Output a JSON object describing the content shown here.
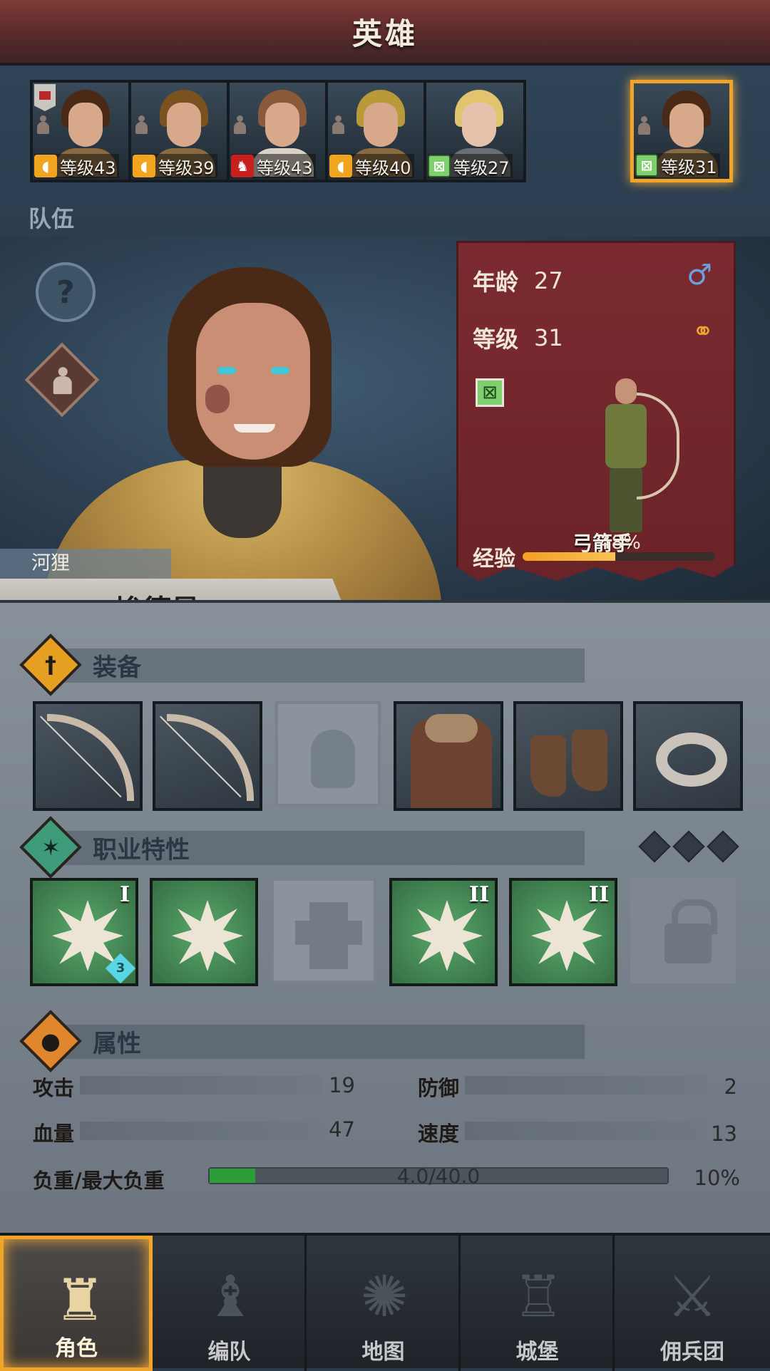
{
  "header": {
    "title": "英雄"
  },
  "roster": [
    {
      "class_icon": "shield-icon",
      "level": "等级43",
      "selected": false,
      "hair": "#4a2a16"
    },
    {
      "class_icon": "shield-icon",
      "level": "等级39",
      "selected": false,
      "hair": "#7a5220"
    },
    {
      "class_icon": "beast-icon",
      "level": "等级43",
      "selected": false,
      "hair": "#8a5a3a"
    },
    {
      "class_icon": "shield-icon",
      "level": "等级40",
      "selected": false,
      "hair": "#b89a3a"
    },
    {
      "class_icon": "bow-icon",
      "level": "等级27",
      "selected": false,
      "hair": "#e2c36e"
    },
    {
      "class_icon": "bow-icon",
      "level": "等级31",
      "selected": true,
      "hair": "#4a2a16"
    }
  ],
  "team_label": "队伍",
  "hero": {
    "nickname": "河狸",
    "name": "埃德曼",
    "age_label": "年龄",
    "age": "27",
    "level_label": "等级",
    "level": "31",
    "class_name": "弓箭手",
    "xp_label": "经验",
    "xp_percent": 48,
    "xp_text": "48%"
  },
  "equipment": {
    "title": "装备"
  },
  "traits": {
    "title": "职业特性"
  },
  "skills": [
    {
      "rank": "I",
      "gem": "3"
    },
    {
      "rank": "",
      "gem": ""
    },
    {
      "rank": "II",
      "gem": ""
    },
    {
      "rank": "II",
      "gem": ""
    }
  ],
  "attributes": {
    "title": "属性",
    "attack_label": "攻击",
    "attack": "19",
    "defense_label": "防御",
    "defense": "2",
    "hp_label": "血量",
    "hp": "47",
    "speed_label": "速度",
    "speed": "13",
    "load_label": "负重/最大负重",
    "load": "4.0/40.0",
    "load_percent": "10%",
    "load_fraction": 0.1
  },
  "nav": [
    {
      "label": "角色",
      "icon": "knight-icon",
      "active": true
    },
    {
      "label": "编队",
      "icon": "helmet-icon",
      "active": false
    },
    {
      "label": "地图",
      "icon": "compass-icon",
      "active": false
    },
    {
      "label": "城堡",
      "icon": "castle-icon",
      "active": false
    },
    {
      "label": "佣兵团",
      "icon": "mercenary-icon",
      "active": false
    }
  ],
  "colors": {
    "accent": "#f0a429",
    "banner": "#7b2b30",
    "xp": "#f4a024",
    "load": "#2f9c3a"
  }
}
